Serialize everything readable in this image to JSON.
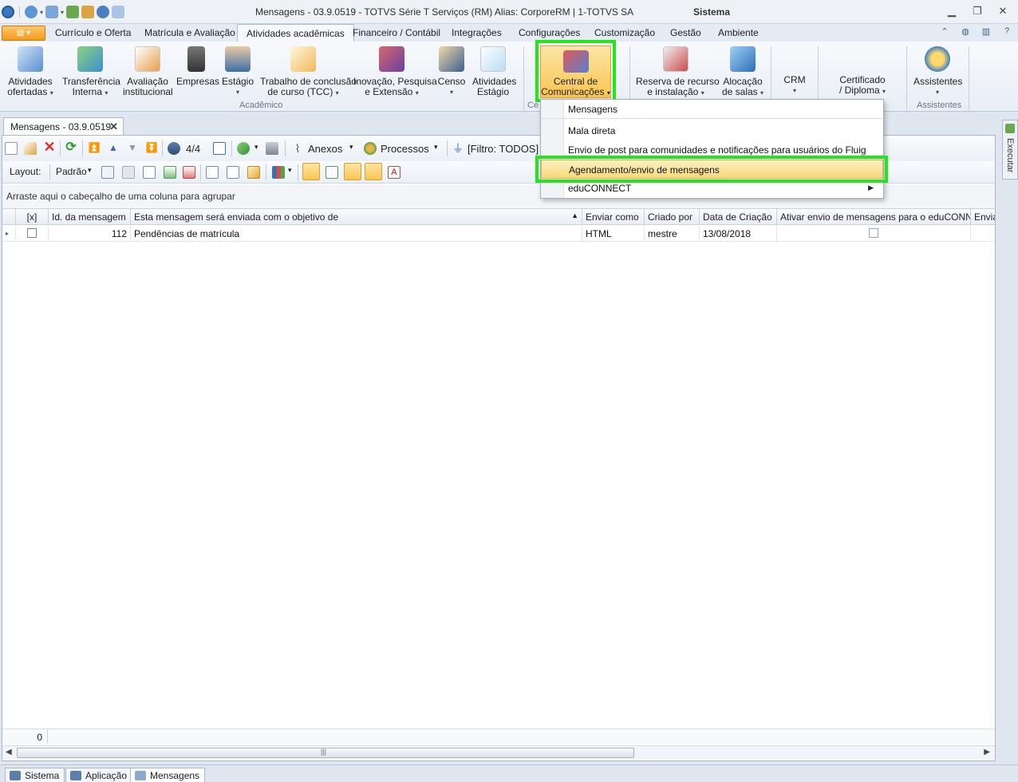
{
  "window": {
    "title": "Mensagens - 03.9.0519 - TOTVS Série T Serviços (RM) Alias: CorporeRM | 1-TOTVS SA",
    "context_label": "Sistema"
  },
  "ribbon_tabs": [
    {
      "label": "Currículo e Oferta"
    },
    {
      "label": "Matrícula e Avaliação"
    },
    {
      "label": "Atividades acadêmicas",
      "active": true
    },
    {
      "label": "Financeiro / Contábil"
    },
    {
      "label": "Integrações"
    },
    {
      "label": "Configurações"
    },
    {
      "label": "Customização"
    },
    {
      "label": "Gestão"
    },
    {
      "label": "Ambiente"
    }
  ],
  "ribbon": {
    "buttons": {
      "atividades_ofertadas": {
        "line1": "Atividades",
        "line2": "ofertadas",
        "icon": "pencil-document-icon"
      },
      "transferencia_interna": {
        "line1": "Transferência",
        "line2": "Interna",
        "icon": "arrows-transfer-icon"
      },
      "avaliacao_institucional": {
        "line1": "Avaliação",
        "line2": "institucional",
        "icon": "chart-document-icon"
      },
      "empresas": {
        "line1": "Empresas",
        "line2": "",
        "icon": "building-icon"
      },
      "estagio": {
        "line1": "Estágio",
        "line2": "",
        "icon": "person-icon"
      },
      "tcc": {
        "line1": "Trabalho de conclusão",
        "line2": "de curso (TCC)",
        "icon": "certificate-icon"
      },
      "inovacao": {
        "line1": "Inovação, Pesquisa",
        "line2": "e Extensão",
        "icon": "books-icon"
      },
      "censo": {
        "line1": "Censo",
        "line2": "",
        "icon": "clipboard-chart-icon"
      },
      "atividades_estagio": {
        "line1": "Atividades",
        "line2": "Estágio",
        "icon": "clipboard-icon"
      },
      "central_comunicacoes": {
        "line1": "Central de",
        "line2": "Comunicações",
        "icon": "people-alert-icon"
      },
      "reserva_recurso": {
        "line1": "Reserva de recurso",
        "line2": "e instalação",
        "icon": "calendar-clock-icon"
      },
      "alocacao_salas": {
        "line1": "Alocação",
        "line2": "de salas",
        "icon": "house-icon"
      },
      "crm": {
        "line1": "CRM",
        "line2": ""
      },
      "certificado": {
        "line1": "Certificado",
        "line2": "/ Diploma"
      },
      "assistentes": {
        "line1": "Assistentes",
        "line2": "",
        "icon": "gears-icon"
      }
    },
    "groups": {
      "academico": "Acadêmico",
      "central_truncated": "Ce",
      "assistentes": "Assistentes"
    }
  },
  "dropdown_menu": {
    "items": [
      {
        "label": "Mensagens"
      },
      {
        "label": "Mala direta"
      },
      {
        "label": "Envio de post para comunidades e notificações para usuários do Fluig"
      },
      {
        "label": "Agendamento/envio de mensagens",
        "highlighted": true
      },
      {
        "label": "eduCONNECT",
        "has_submenu": true
      }
    ]
  },
  "document_tab": {
    "label": "Mensagens - 03.9.0519"
  },
  "toolbar": {
    "record_counter": "4/4",
    "anexos_label": "Anexos",
    "processos_label": "Processos",
    "filter_label": "[Filtro: TODOS]",
    "layout_label": "Layout:",
    "layout_value": "Padrão"
  },
  "grid": {
    "group_hint": "Arraste aqui o cabeçalho de uma coluna para agrupar",
    "columns": [
      {
        "label": "[x]"
      },
      {
        "label": "Id. da mensagem"
      },
      {
        "label": "Esta mensagem será enviada com o objetivo de"
      },
      {
        "label": "Enviar como"
      },
      {
        "label": "Criado por"
      },
      {
        "label": "Data de Criação"
      },
      {
        "label": "Ativar envio de mensagens para o eduCONNECT"
      },
      {
        "label": "Envia"
      }
    ],
    "rows": [
      {
        "id": "112",
        "objetivo": "Pendências de matrícula",
        "enviar_como": "HTML",
        "criado_por": "mestre",
        "data_criacao": "13/08/2018"
      }
    ],
    "footer_count": "0"
  },
  "side_panel": {
    "label": "Executar"
  },
  "statusbar": {
    "tabs": [
      {
        "label": "Sistema"
      },
      {
        "label": "Aplicação"
      },
      {
        "label": "Mensagens"
      }
    ]
  },
  "colors": {
    "highlight_green": "#22e61a",
    "accent_orange": "#f29a1a",
    "selected_gold": "#f9c550"
  }
}
